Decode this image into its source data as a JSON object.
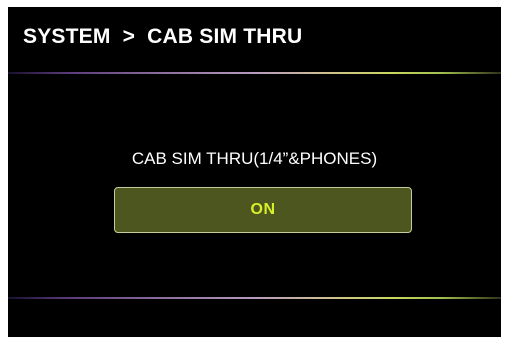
{
  "header": {
    "title": "SYSTEM  >  CAB SIM THRU"
  },
  "setting": {
    "label": "CAB SIM THRU(1/4”&PHONES)",
    "value": "ON"
  },
  "colors": {
    "background": "#000000",
    "text": "#ffffff",
    "button_fill": "#4e561f",
    "button_text": "#d8f02a"
  }
}
